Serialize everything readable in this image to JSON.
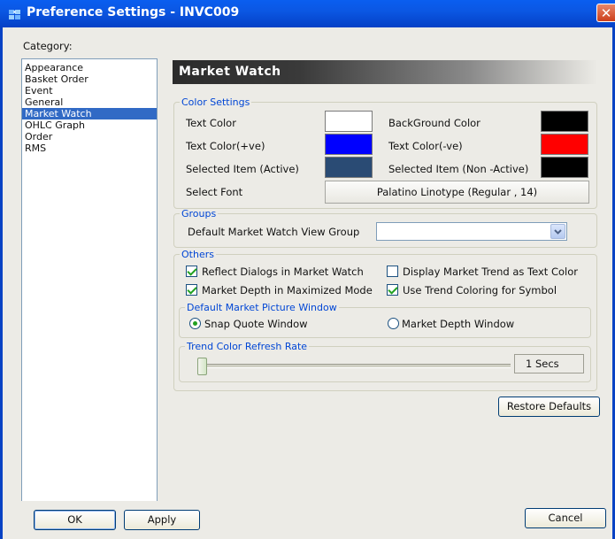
{
  "window": {
    "title": "Preference Settings - INVC009",
    "close_symbol": "✕",
    "title_color": "#0554e6"
  },
  "category": {
    "label": "Category:",
    "items": [
      "Appearance",
      "Basket Order",
      "Event",
      "General",
      "Market Watch",
      "OHLC Graph",
      "Order",
      "RMS"
    ],
    "selected": "Market Watch"
  },
  "panel": {
    "title": "Market Watch"
  },
  "color_settings": {
    "legend": "Color Settings",
    "text_color": {
      "label": "Text Color",
      "color": "#ffffff"
    },
    "background_color": {
      "label": "BackGround Color",
      "color": "#000000"
    },
    "text_color_pos": {
      "label": "Text Color(+ve)",
      "color": "#0000ff"
    },
    "text_color_neg": {
      "label": "Text Color(-ve)",
      "color": "#ff0000"
    },
    "selected_active": {
      "label": "Selected Item (Active)",
      "color": "#2a4b74"
    },
    "selected_inactive": {
      "label": "Selected Item (Non -Active)",
      "color": "#000000"
    },
    "font": {
      "label": "Select Font",
      "value": "Palatino Linotype (Regular , 14)"
    }
  },
  "groups": {
    "legend": "Groups",
    "default_view_label": "Default Market Watch View Group",
    "default_view_value": ""
  },
  "others": {
    "legend": "Others",
    "reflect_dialogs": {
      "label": "Reflect Dialogs in Market Watch",
      "checked": true
    },
    "display_trend_text": {
      "label": "Display Market Trend as Text Color",
      "checked": false
    },
    "market_depth_max": {
      "label": "Market Depth in Maximized Mode",
      "checked": true
    },
    "trend_coloring_symbol": {
      "label": "Use Trend Coloring for Symbol",
      "checked": true
    },
    "picture_window": {
      "legend": "Default Market Picture Window",
      "snap_quote": {
        "label": "Snap Quote Window",
        "selected": true
      },
      "market_depth": {
        "label": "Market Depth Window",
        "selected": false
      }
    },
    "refresh_rate": {
      "legend": "Trend Color Refresh Rate",
      "value_text": "1 Secs",
      "slider_fraction": 0.0
    }
  },
  "buttons": {
    "restore_defaults": "Restore Defaults",
    "ok": "OK",
    "apply": "Apply",
    "cancel": "Cancel"
  }
}
